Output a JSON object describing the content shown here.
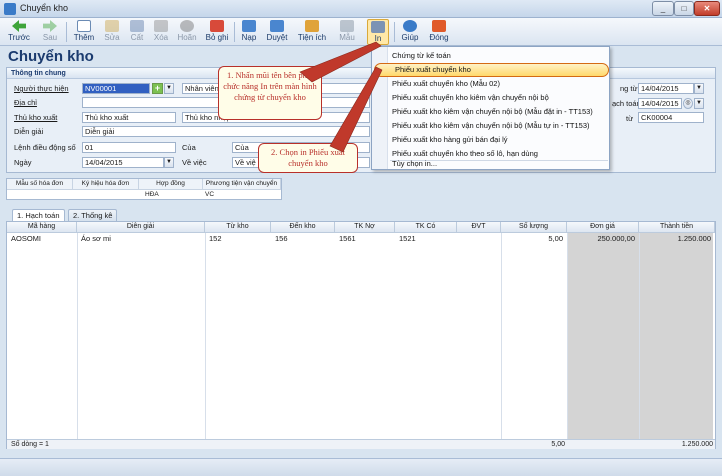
{
  "window": {
    "title": "Chuyển kho",
    "minimize": "_",
    "maximize": "□",
    "close": "✕"
  },
  "toolbar": {
    "buttons": [
      {
        "label": "Trước",
        "icon": "arrow-left-icon"
      },
      {
        "label": "Sau",
        "icon": "arrow-right-icon"
      },
      {
        "label": "Thêm",
        "icon": "add-document-icon"
      },
      {
        "label": "Sửa",
        "icon": "edit-icon"
      },
      {
        "label": "Cất",
        "icon": "save-icon"
      },
      {
        "label": "Xóa",
        "icon": "delete-icon"
      },
      {
        "label": "Hoãn",
        "icon": "undo-icon"
      },
      {
        "label": "Bỏ ghi",
        "icon": "unpost-icon"
      },
      {
        "label": "Nạp",
        "icon": "refresh-icon"
      },
      {
        "label": "Duyệt",
        "icon": "browse-icon"
      },
      {
        "label": "Tiện ích",
        "icon": "utilities-icon"
      },
      {
        "label": "Mẫu",
        "icon": "template-icon"
      },
      {
        "label": "In",
        "icon": "print-icon"
      },
      {
        "label": "Giúp",
        "icon": "help-icon"
      },
      {
        "label": "Đóng",
        "icon": "close-icon"
      }
    ]
  },
  "form": {
    "title": "Chuyển kho",
    "section_title": "Thông tin chung",
    "fields": {
      "nguoi_thuc_hien_label": "Người thực hiện",
      "nguoi_thuc_hien_value": "NV00001",
      "nhan_vien_value": "Nhân viên",
      "dia_chi_label": "Địa chỉ",
      "thu_kho_xuat_label": "Thủ kho xuất",
      "thu_kho_xuat_value": "Thủ kho xuất",
      "thu_kho_nhap_value": "Thủ kho nhập",
      "dien_giai_label": "Diễn giải",
      "dien_giai_value": "Diễn giải",
      "lenh_dieu_dong_label": "Lệnh điều động số",
      "lenh_dieu_dong_value": "01",
      "cua_label": "Của",
      "cua_value": "Của",
      "ngay_label": "Ngày",
      "ngay_value": "14/04/2015",
      "ve_viec_label": "Về việc",
      "ve_viec_value": "Về việ",
      "ngay_chung_tu_label": "ng từ",
      "ngay_chung_tu_value": "14/04/2015",
      "ngay_hach_toan_label": "ạch toán",
      "ngay_hach_toan_value": "14/04/2015",
      "so_chung_tu_label": "từ",
      "so_chung_tu_value": "CK00004"
    }
  },
  "invoice": {
    "headers": [
      "Mẫu số hóa đơn",
      "Ký hiệu hóa đơn",
      "Hợp đồng",
      "Phương tiện vận chuyển"
    ],
    "values": [
      "",
      "",
      "HĐA",
      "VC"
    ]
  },
  "tabs": [
    "1. Hạch toán",
    "2. Thống kê"
  ],
  "grid": {
    "headers": [
      "Mã hàng",
      "Diễn giải",
      "Từ kho",
      "Đến kho",
      "TK Nợ",
      "TK Có",
      "ĐVT",
      "Số lượng",
      "Đơn giá",
      "Thành tiền"
    ],
    "rows": [
      [
        "AOSOMI",
        "Áo sơ mi",
        "152",
        "156",
        "1561",
        "1521",
        "",
        "5,00",
        "250.000,00",
        "1.250.000"
      ]
    ],
    "footer": {
      "row_count": "Số dòng = 1",
      "qty_total": "5,00",
      "amount_total": "1.250.000"
    }
  },
  "print_menu": {
    "items": [
      "Chứng từ kế toán",
      "Phiếu xuất chuyển kho",
      "Phiếu xuất chuyển kho (Mẫu 02)",
      "Phiếu xuất chuyển kho kiêm vận chuyển nội bộ",
      "Phiếu xuất kho kiêm vận chuyển nội bộ (Mẫu đặt in - TT153)",
      "Phiếu xuất kho kiêm vận chuyển nội bộ (Mẫu tự in - TT153)",
      "Phiếu xuất kho hàng gửi bán đại lý",
      "Phiếu xuất chuyển kho theo số lô, hạn dùng",
      "Tùy chọn in..."
    ]
  },
  "callouts": {
    "step1": "1. Nhấn mũi tên bên phải chức năng In trên màn hình chứng từ chuyển kho",
    "step2": "2. Chọn in Phiếu xuất chuyển kho"
  },
  "colors": {
    "accent": "#3160c1",
    "callout": "#b8302a",
    "highlight": "#ffd96b"
  }
}
